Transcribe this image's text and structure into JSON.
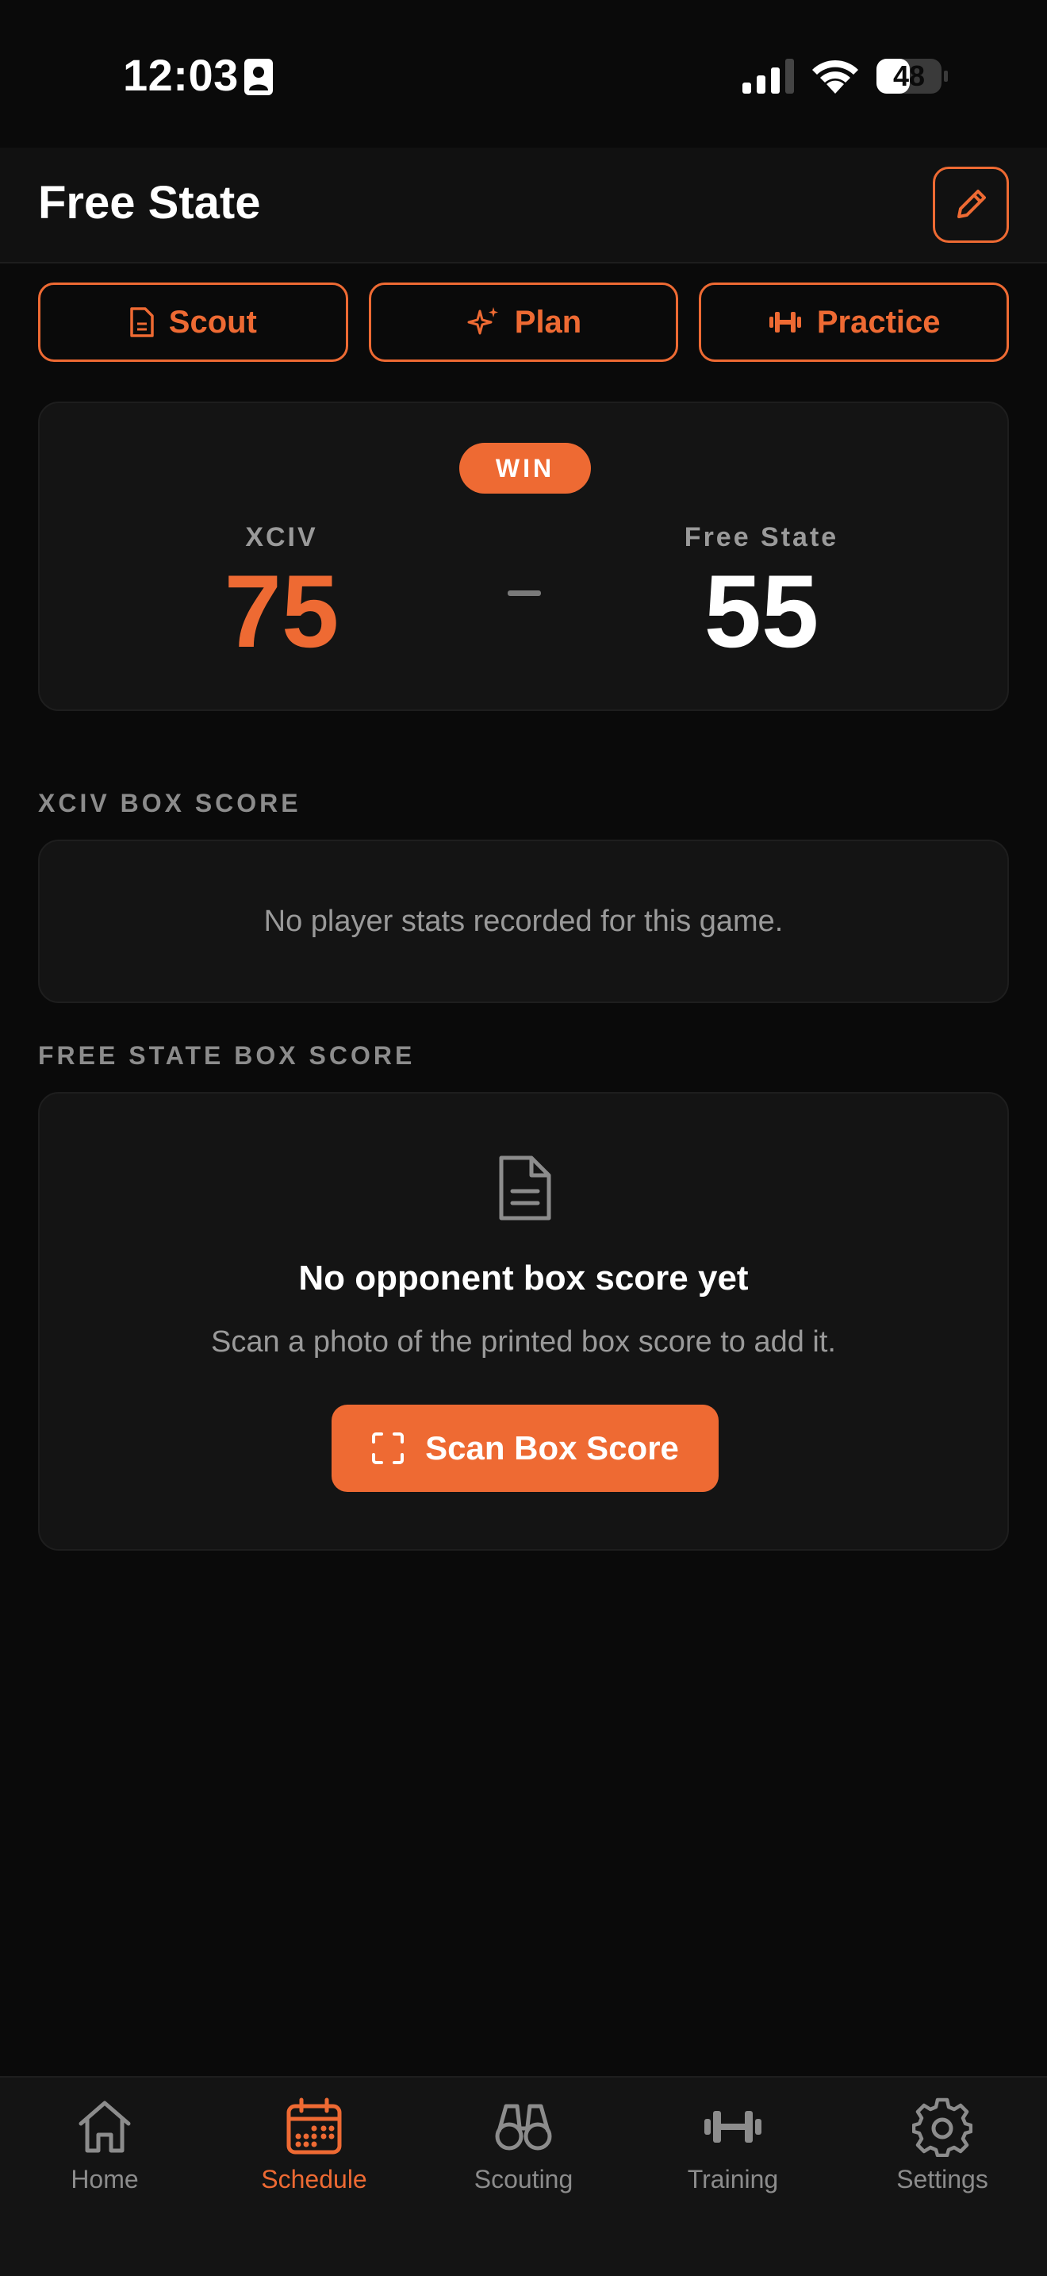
{
  "status": {
    "time": "12:03",
    "battery": "48"
  },
  "header": {
    "title": "Free State"
  },
  "actions": [
    {
      "label": "Scout",
      "icon": "document-icon"
    },
    {
      "label": "Plan",
      "icon": "sparkles-icon"
    },
    {
      "label": "Practice",
      "icon": "dumbbell-icon"
    }
  ],
  "score": {
    "result": "WIN",
    "home_team": "XCIV",
    "home_score": "75",
    "away_team": "Free State",
    "away_score": "55"
  },
  "home_box": {
    "label": "XCIV BOX SCORE",
    "empty_text": "No player stats recorded for this game."
  },
  "away_box": {
    "label": "FREE STATE BOX SCORE",
    "title": "No opponent box score yet",
    "subtitle": "Scan a photo of the printed box score to add it.",
    "scan_label": "Scan Box Score"
  },
  "tabs": [
    {
      "label": "Home",
      "icon": "home-icon"
    },
    {
      "label": "Schedule",
      "icon": "calendar-icon",
      "active": true
    },
    {
      "label": "Scouting",
      "icon": "binoculars-icon"
    },
    {
      "label": "Training",
      "icon": "dumbbell-icon"
    },
    {
      "label": "Settings",
      "icon": "gear-icon"
    }
  ],
  "colors": {
    "accent": "#ee6a33",
    "background": "#0a0a0a",
    "card": "#141414"
  }
}
